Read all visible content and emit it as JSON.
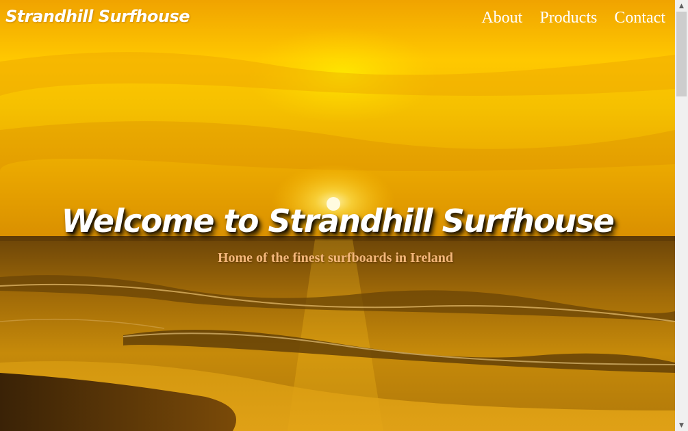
{
  "navbar": {
    "brand": "Strandhill Surfhouse",
    "links": [
      {
        "label": "About"
      },
      {
        "label": "Products"
      },
      {
        "label": "Contact"
      }
    ]
  },
  "hero": {
    "title": "Welcome to Strandhill Surfhouse",
    "subtitle": "Home of the finest surfboards in Ireland",
    "background": "sunset-beach-image"
  },
  "colors": {
    "sky_top": "#f2a400",
    "sky_mid": "#ffd200",
    "sea": "#8a5a08",
    "subtitle": "#f4b77a"
  },
  "scrollbar": {
    "up_icon": "chevron-up-icon",
    "down_icon": "chevron-down-icon"
  }
}
